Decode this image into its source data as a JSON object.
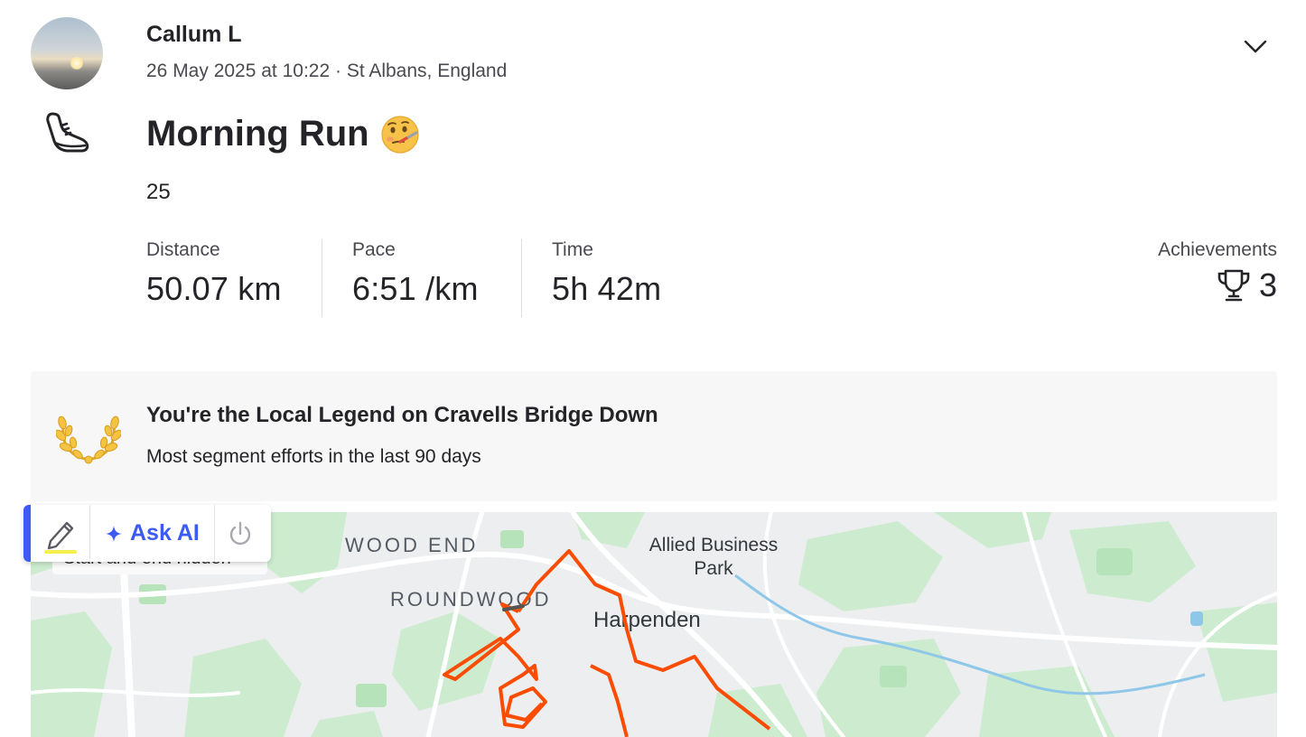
{
  "athlete": {
    "name": "Callum L",
    "meta": "26 May 2025 at 10:22 · St Albans, England"
  },
  "activity": {
    "title": "Morning Run",
    "description": "25",
    "sport_icon": "running-shoe-icon",
    "title_emoji": "face-with-thermometer"
  },
  "stats": [
    {
      "label": "Distance",
      "value": "50.07 km"
    },
    {
      "label": "Pace",
      "value": "6:51 /km"
    },
    {
      "label": "Time",
      "value": "5h 42m"
    }
  ],
  "achievements": {
    "label": "Achievements",
    "count": "3",
    "icon": "trophy-icon"
  },
  "local_legend": {
    "title": "You're the Local Legend on Cravells Bridge Down",
    "subtitle": "Most segment efforts in the last 90 days",
    "icon": "laurel-wreath-icon",
    "accent_color": "#f5c342"
  },
  "map": {
    "labels": {
      "wood_end": "WOOD END",
      "roundwood": "ROUNDWOOD",
      "allied": "Allied Business Park",
      "harpenden": "Harpenden"
    },
    "overlay_note": "Start and end hidden",
    "route_color": "#fc4c02"
  },
  "toolbar": {
    "ask_label": "Ask AI",
    "accent_color": "#3c5af5"
  }
}
